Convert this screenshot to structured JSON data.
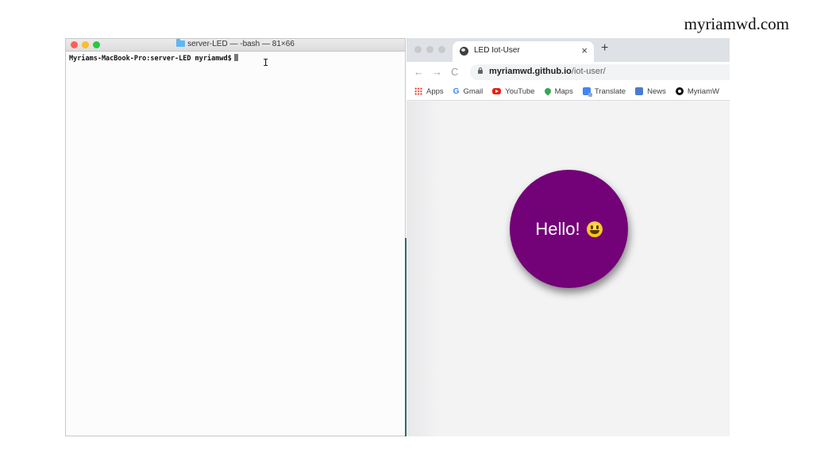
{
  "watermark": "myriamwd.com",
  "terminal": {
    "title": "server-LED — -bash — 81×66",
    "prompt": "Myriams-MacBook-Pro:server-LED myriamwd$"
  },
  "browser": {
    "tab_title": "LED Iot-User",
    "tab_close": "×",
    "new_tab": "+",
    "url_domain": "myriamwd.github.io",
    "url_path": "/iot-user/",
    "nav": {
      "back": "←",
      "forward": "→",
      "reload": "C"
    },
    "bookmarks": [
      {
        "label": "Apps",
        "icon": "apps-icon"
      },
      {
        "label": "Gmail",
        "icon": "gmail-icon"
      },
      {
        "label": "YouTube",
        "icon": "youtube-icon"
      },
      {
        "label": "Maps",
        "icon": "maps-icon"
      },
      {
        "label": "Translate",
        "icon": "translate-icon"
      },
      {
        "label": "News",
        "icon": "news-icon"
      },
      {
        "label": "MyriamW",
        "icon": "github-icon"
      }
    ]
  },
  "page": {
    "hello_text": "Hello!",
    "button_color": "#730178"
  }
}
